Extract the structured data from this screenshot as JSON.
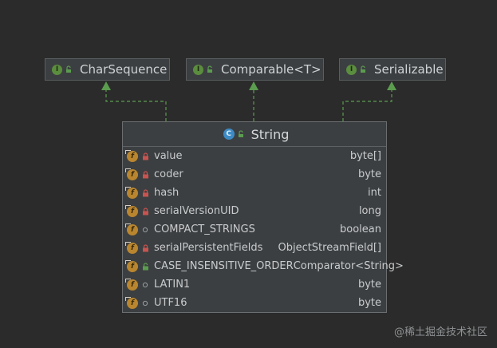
{
  "interfaces": [
    {
      "name": "CharSequence"
    },
    {
      "name": "Comparable<T>"
    },
    {
      "name": "Serializable"
    }
  ],
  "class": {
    "name": "String",
    "fields": [
      {
        "name": "value",
        "type": "byte[]",
        "visibility": "private"
      },
      {
        "name": "coder",
        "type": "byte",
        "visibility": "private"
      },
      {
        "name": "hash",
        "type": "int",
        "visibility": "private"
      },
      {
        "name": "serialVersionUID",
        "type": "long",
        "visibility": "private"
      },
      {
        "name": "COMPACT_STRINGS",
        "type": "boolean",
        "visibility": "package"
      },
      {
        "name": "serialPersistentFields",
        "type": "ObjectStreamField[]",
        "visibility": "private"
      },
      {
        "name": "CASE_INSENSITIVE_ORDER",
        "type": "Comparator<String>",
        "visibility": "public"
      },
      {
        "name": "LATIN1",
        "type": "byte",
        "visibility": "package"
      },
      {
        "name": "UTF16",
        "type": "byte",
        "visibility": "package"
      }
    ]
  },
  "badges": {
    "interface": "I",
    "class": "C",
    "field": "f"
  },
  "colors": {
    "background": "#2b2b2b",
    "node_fill": "#3c3f41",
    "connector": "#5b9c4f",
    "interface_badge": "#5b8d3f",
    "class_badge": "#3d8bc4",
    "field_badge": "#b9862f",
    "private_lock": "#c75450",
    "public_lock": "#5b9c4f"
  },
  "watermark": "@稀土掘金技术社区"
}
